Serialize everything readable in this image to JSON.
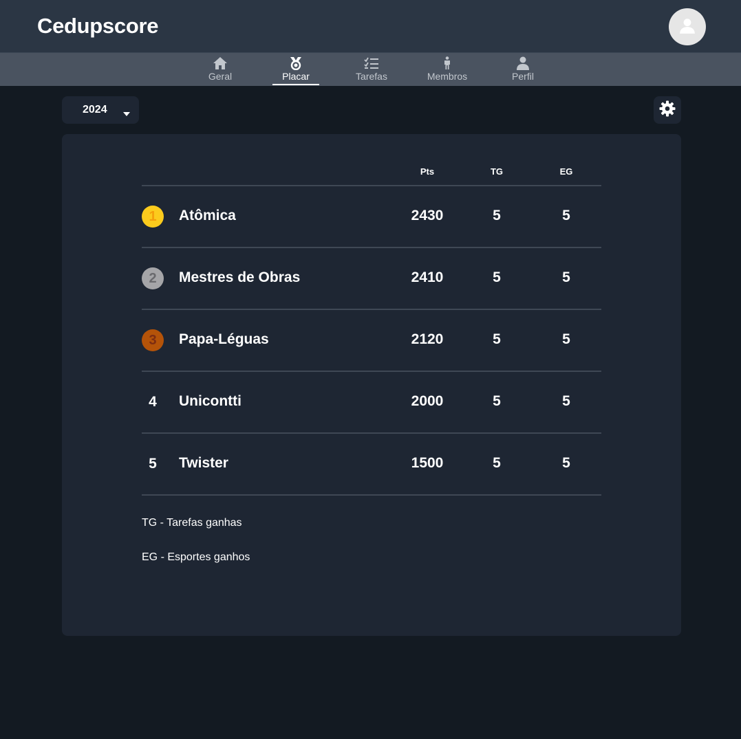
{
  "header": {
    "title": "Cedupscore",
    "avatar_icon": "user-avatar-icon"
  },
  "nav": {
    "items": [
      {
        "label": "Geral",
        "icon": "home-icon"
      },
      {
        "label": "Placar",
        "icon": "medal-icon",
        "active": true
      },
      {
        "label": "Tarefas",
        "icon": "checklist-icon"
      },
      {
        "label": "Membros",
        "icon": "person-standing-icon"
      },
      {
        "label": "Perfil",
        "icon": "user-icon"
      }
    ]
  },
  "toolbar": {
    "year": "2024",
    "settings_icon": "gear-icon"
  },
  "table": {
    "columns": [
      "Pts",
      "TG",
      "EG"
    ],
    "rows": [
      {
        "rank": "1",
        "team": "Atômica",
        "pts": "2430",
        "tg": "5",
        "eg": "5"
      },
      {
        "rank": "2",
        "team": "Mestres de Obras",
        "pts": "2410",
        "tg": "5",
        "eg": "5"
      },
      {
        "rank": "3",
        "team": "Papa-Léguas",
        "pts": "2120",
        "tg": "5",
        "eg": "5"
      },
      {
        "rank": "4",
        "team": "Unicontti",
        "pts": "2000",
        "tg": "5",
        "eg": "5"
      },
      {
        "rank": "5",
        "team": "Twister",
        "pts": "1500",
        "tg": "5",
        "eg": "5"
      }
    ]
  },
  "legend": {
    "tg": "TG - Tarefas ganhas",
    "eg": "EG - Esportes ganhos"
  },
  "colors": {
    "gold": "#fccb1d",
    "gold_text": "#f59e0b",
    "silver": "#a5a5a8",
    "silver_text": "#6a6a6e",
    "bronze": "#b45309",
    "bronze_text": "#7c2d12"
  }
}
